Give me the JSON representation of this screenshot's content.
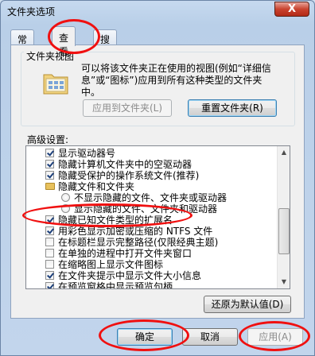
{
  "window": {
    "title": "文件夹选项",
    "close_glyph": "X"
  },
  "tabs": [
    {
      "label": "常规",
      "active": false
    },
    {
      "label": "查看",
      "active": true
    },
    {
      "label": "搜索",
      "active": false
    }
  ],
  "folder_view": {
    "legend": "文件夹视图",
    "description": "可以将该文件夹正在使用的视图(例如“详细信息”或“图标”)应用到所有这种类型的文件夹中。",
    "apply_button": "应用到文件夹(L)",
    "reset_button": "重置文件夹(R)"
  },
  "advanced": {
    "label": "高级设置:",
    "items": [
      {
        "kind": "checkbox",
        "checked": true,
        "label": "显示驱动器号",
        "indent": 0
      },
      {
        "kind": "checkbox",
        "checked": true,
        "label": "隐藏计算机文件夹中的空驱动器",
        "indent": 0
      },
      {
        "kind": "checkbox",
        "checked": true,
        "label": "隐藏受保护的操作系统文件(推荐)",
        "indent": 0
      },
      {
        "kind": "folder",
        "checked": false,
        "label": "隐藏文件和文件夹",
        "indent": 0
      },
      {
        "kind": "radio",
        "checked": false,
        "label": "不显示隐藏的文件、文件夹或驱动器",
        "indent": 1
      },
      {
        "kind": "radio",
        "checked": false,
        "label": "显示隐藏的文件、文件夹和驱动器",
        "indent": 1
      },
      {
        "kind": "checkbox",
        "checked": true,
        "label": "隐藏已知文件类型的扩展名",
        "indent": 0
      },
      {
        "kind": "checkbox",
        "checked": true,
        "label": "用彩色显示加密或压缩的 NTFS 文件",
        "indent": 0
      },
      {
        "kind": "checkbox",
        "checked": false,
        "label": "在标题栏显示完整路径(仅限经典主题)",
        "indent": 0
      },
      {
        "kind": "checkbox",
        "checked": false,
        "label": "在单独的进程中打开文件夹窗口",
        "indent": 0
      },
      {
        "kind": "checkbox",
        "checked": false,
        "label": "在缩略图上显示文件图标",
        "indent": 0
      },
      {
        "kind": "checkbox",
        "checked": true,
        "label": "在文件夹提示中显示文件大小信息",
        "indent": 0
      },
      {
        "kind": "checkbox",
        "checked": true,
        "label": "在预览窗格中显示预览句柄",
        "indent": 0
      }
    ],
    "restore_button": "还原为默认值(D)"
  },
  "footer": {
    "ok": "确定",
    "cancel": "取消",
    "apply": "应用(A)"
  },
  "colors": {
    "annotation_red": "#f01010"
  }
}
